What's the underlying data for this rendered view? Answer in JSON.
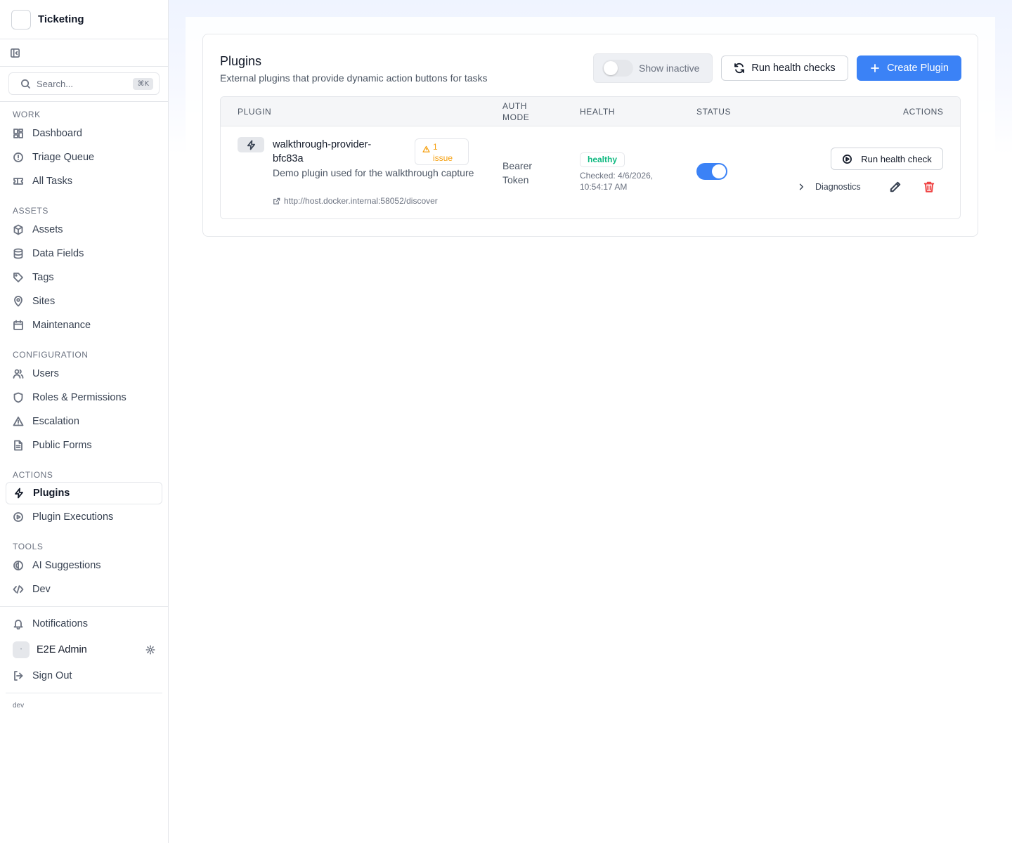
{
  "app": {
    "title": "Ticketing",
    "version": "dev"
  },
  "search": {
    "placeholder": "Search...",
    "shortcut": "⌘K"
  },
  "sidebar": {
    "sections": [
      {
        "label": "WORK",
        "items": [
          "Dashboard",
          "Triage Queue",
          "All Tasks"
        ]
      },
      {
        "label": "ASSETS",
        "items": [
          "Assets",
          "Data Fields",
          "Tags",
          "Sites",
          "Maintenance"
        ]
      },
      {
        "label": "CONFIGURATION",
        "items": [
          "Users",
          "Roles & Permissions",
          "Escalation",
          "Public Forms"
        ]
      },
      {
        "label": "ACTIONS",
        "items": [
          "Plugins",
          "Plugin Executions"
        ]
      },
      {
        "label": "TOOLS",
        "items": [
          "AI Suggestions",
          "Dev"
        ]
      }
    ],
    "active_item": "Plugins",
    "notifications": "Notifications",
    "user_name": "E2E Admin",
    "sign_out": "Sign Out"
  },
  "page": {
    "title": "Plugins",
    "subtitle": "External plugins that provide dynamic action buttons for tasks",
    "show_inactive_label": "Show inactive",
    "show_inactive": false,
    "run_health_checks_label": "Run health checks",
    "create_plugin_label": "Create Plugin"
  },
  "table": {
    "headers": {
      "plugin": "PLUGIN",
      "auth_mode_line1": "AUTH",
      "auth_mode_line2": "MODE",
      "health": "HEALTH",
      "status": "STATUS",
      "actions": "ACTIONS"
    },
    "rows": [
      {
        "name": "walkthrough-provider-bfc83a",
        "issue_count": "1",
        "issue_word": "issue",
        "description": "Demo plugin used for the walkthrough capture",
        "url": "http://host.docker.internal:58052/discover",
        "auth_mode": "Bearer Token",
        "health": "healthy",
        "checked": "Checked: 4/6/2026, 10:54:17 AM",
        "status_enabled": true,
        "run_check_label": "Run health check",
        "diagnostics_label": "Diagnostics"
      }
    ]
  },
  "colors": {
    "primary": "#3b82f6",
    "healthy": "#10b981",
    "warning": "#f59e0b",
    "danger": "#ef4444"
  }
}
